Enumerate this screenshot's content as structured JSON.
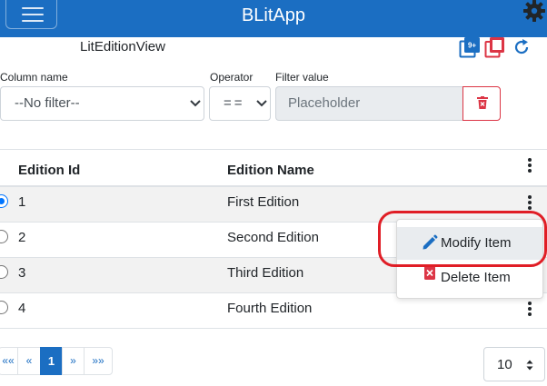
{
  "app": {
    "title": "BLitApp",
    "brand_color": "#1b6ec2"
  },
  "view": {
    "title": "LitEditionView",
    "icons": [
      "add-multiple-icon",
      "copy-icon",
      "refresh-icon"
    ]
  },
  "filter": {
    "column_label": "Column name",
    "column_value": "--No filter--",
    "operator_label": "Operator",
    "operator_value": "==",
    "value_label": "Filter value",
    "value_placeholder": "Placeholder"
  },
  "table": {
    "columns": [
      "Edition Id",
      "Edition Name"
    ],
    "rows": [
      {
        "id": "1",
        "name": "First Edition",
        "selected": true
      },
      {
        "id": "2",
        "name": "Second Edition",
        "selected": false
      },
      {
        "id": "3",
        "name": "Third Edition",
        "selected": false
      },
      {
        "id": "4",
        "name": "Fourth Edition",
        "selected": false
      }
    ]
  },
  "context_menu": {
    "items": [
      {
        "label": "Modify Item",
        "icon": "pencil-icon"
      },
      {
        "label": "Delete Item",
        "icon": "delete-x-icon"
      }
    ]
  },
  "pagination": {
    "first": "««",
    "prev": "«",
    "current": "1",
    "next": "»",
    "last": "»»",
    "page_size": "10"
  }
}
